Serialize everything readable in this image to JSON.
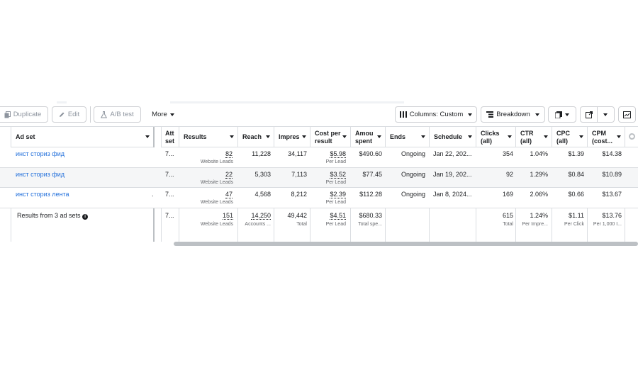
{
  "toolbar": {
    "duplicate": "Duplicate",
    "edit": "Edit",
    "ab_test": "A/B test",
    "more": "More",
    "columns": "Columns: Custom",
    "breakdown": "Breakdown"
  },
  "columns": {
    "adset": "Ad set",
    "attr": "Att\nset",
    "results": "Results",
    "reach": "Reach",
    "impr": "Impres",
    "cpr": "Cost per\nresult",
    "amount": "Amou\nspent",
    "ends": "Ends",
    "schedule": "Schedule",
    "clicks": "Clicks\n(all)",
    "ctr": "CTR\n(all)",
    "cpc": "CPC\n(all)",
    "cpm": "CPM\n(cost..."
  },
  "rows": [
    {
      "name": "инст сториз фид",
      "attr": "7...",
      "results": "82",
      "results_sub": "Website Leads",
      "reach": "11,228",
      "impr": "34,117",
      "cpr": "$5.98",
      "cpr_sub": "Per Lead",
      "amount": "$490.60",
      "ends": "Ongoing",
      "schedule": "Jan 22, 202...",
      "clicks": "354",
      "ctr": "1.04%",
      "cpc": "$1.39",
      "cpm": "$14.38"
    },
    {
      "name": "инст сториз фид",
      "attr": "7...",
      "results": "22",
      "results_sub": "Website Leads",
      "reach": "5,303",
      "impr": "7,113",
      "cpr": "$3.52",
      "cpr_sub": "Per Lead",
      "amount": "$77.45",
      "ends": "Ongoing",
      "schedule": "Jan 19, 202...",
      "clicks": "92",
      "ctr": "1.29%",
      "cpc": "$0.84",
      "cpm": "$10.89"
    },
    {
      "name": "инст сториз лента",
      "attr": "7...",
      "results": "47",
      "results_sub": "Website Leads",
      "reach": "4,568",
      "impr": "8,212",
      "cpr": "$2.39",
      "cpr_sub": "Per Lead",
      "amount": "$112.28",
      "ends": "Ongoing",
      "schedule": "Jan 8, 2024...",
      "clicks": "169",
      "ctr": "2.06%",
      "cpc": "$0.66",
      "cpm": "$13.67"
    }
  ],
  "totals": {
    "label": "Results from 3 ad sets",
    "attr": "7...",
    "results": "151",
    "results_sub": "Website Leads",
    "reach": "14,250",
    "reach_sub": "Accounts ...",
    "impr": "49,442",
    "impr_sub": "Total",
    "cpr": "$4.51",
    "cpr_sub": "Per Lead",
    "amount": "$680.33",
    "amount_sub": "Total spe...",
    "clicks": "615",
    "clicks_sub": "Total",
    "ctr": "1.24%",
    "ctr_sub": "Per Impre...",
    "cpc": "$1.11",
    "cpc_sub": "Per Click",
    "cpm": "$13.76",
    "cpm_sub": "Per 1,000 I..."
  },
  "icons": [
    "duplicate-icon",
    "pencil-icon",
    "flask-icon",
    "columns-icon",
    "breakdown-icon",
    "reports-icon",
    "export-icon",
    "chart-icon",
    "settings-icon",
    "info-icon"
  ]
}
